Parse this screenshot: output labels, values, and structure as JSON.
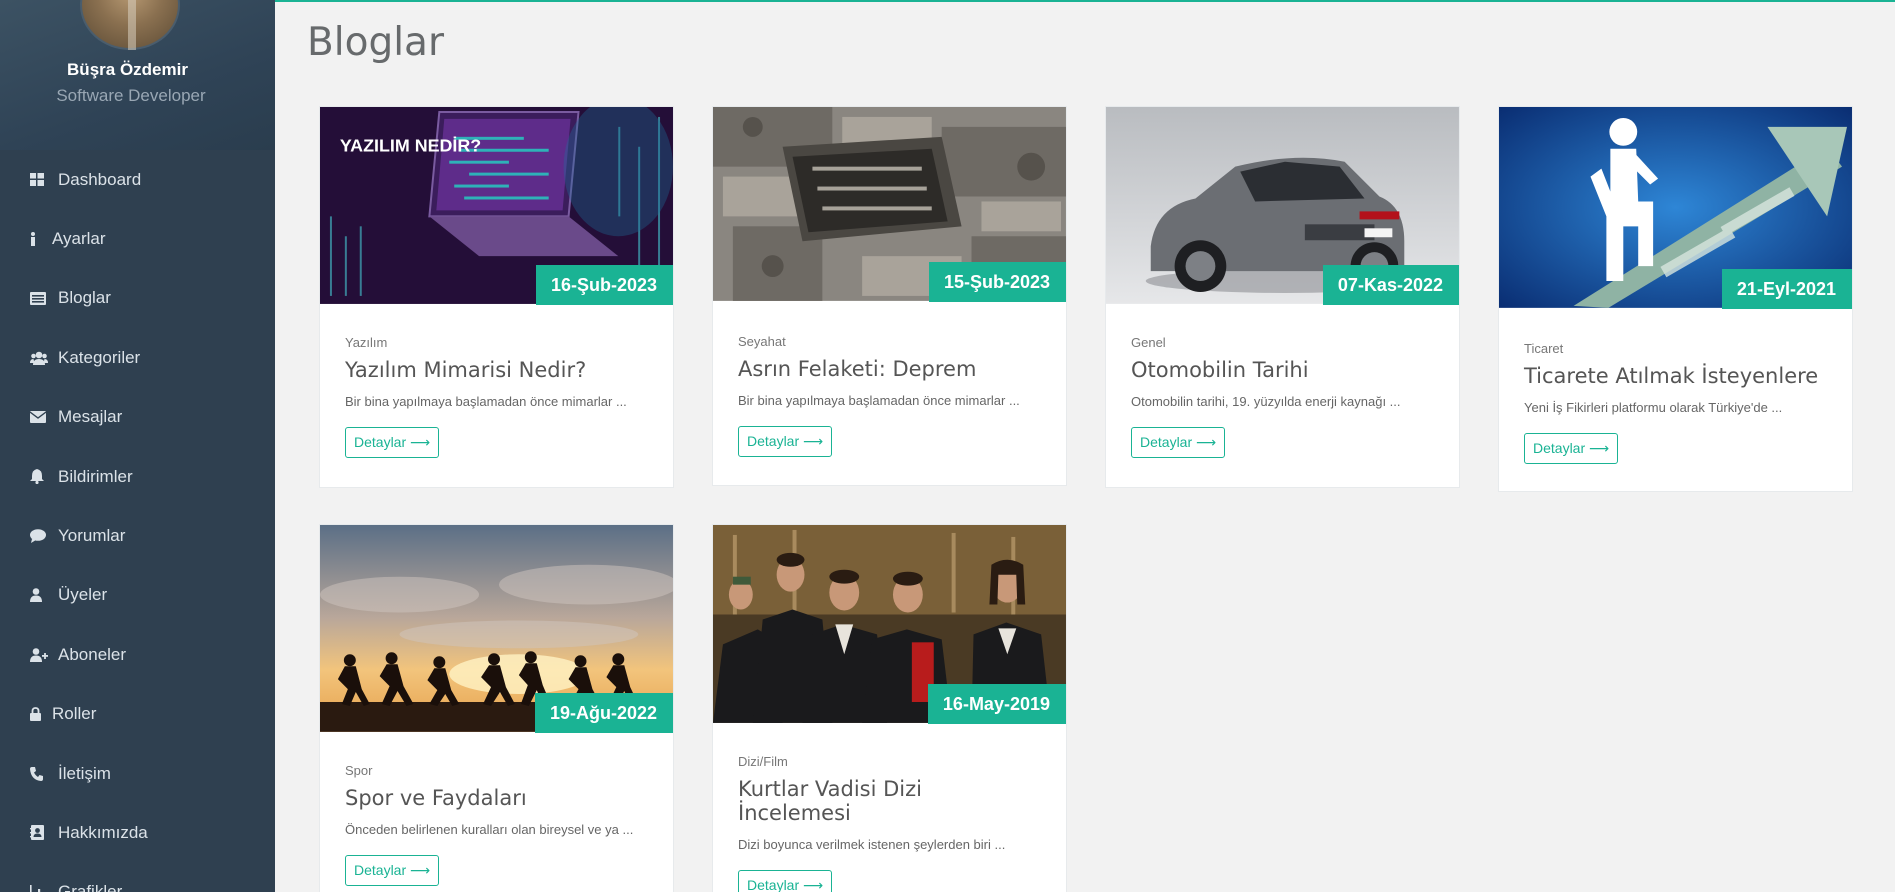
{
  "profile": {
    "name": "Büşra Özdemir",
    "role": "Software Developer"
  },
  "sidebar": {
    "items": [
      {
        "label": "Dashboard",
        "icon": "dashboard-icon"
      },
      {
        "label": "Ayarlar",
        "icon": "info-icon"
      },
      {
        "label": "Bloglar",
        "icon": "list-alt-icon"
      },
      {
        "label": "Kategoriler",
        "icon": "users-icon"
      },
      {
        "label": "Mesajlar",
        "icon": "envelope-icon"
      },
      {
        "label": "Bildirimler",
        "icon": "bell-icon"
      },
      {
        "label": "Yorumlar",
        "icon": "comment-icon"
      },
      {
        "label": "Üyeler",
        "icon": "user-icon"
      },
      {
        "label": "Aboneler",
        "icon": "user-plus-icon"
      },
      {
        "label": "Roller",
        "icon": "lock-icon"
      },
      {
        "label": "İletişim",
        "icon": "phone-icon"
      },
      {
        "label": "Hakkımızda",
        "icon": "address-book-icon"
      },
      {
        "label": "Grafikler",
        "icon": "chart-icon"
      }
    ]
  },
  "main": {
    "title": "Bloglar",
    "cards": [
      {
        "date": "16-Şub-2023",
        "category": "Yazılım",
        "title": "Yazılım Mimarisi Nedir?",
        "excerpt": "Bir bina yapılmaya başlamadan önce mimarlar ...",
        "button": "Detaylar ⟶",
        "image_text": "YAZILIM NEDİR?"
      },
      {
        "date": "15-Şub-2023",
        "category": "Seyahat",
        "title": "Asrın Felaketi: Deprem",
        "excerpt": "Bir bina yapılmaya başlamadan önce mimarlar ...",
        "button": "Detaylar ⟶"
      },
      {
        "date": "07-Kas-2022",
        "category": "Genel",
        "title": "Otomobilin Tarihi",
        "excerpt": "Otomobilin tarihi, 19. yüzyılda enerji kaynağı ...",
        "button": "Detaylar ⟶"
      },
      {
        "date": "21-Eyl-2021",
        "category": "Ticaret",
        "title": "Ticarete Atılmak İsteyenlere",
        "excerpt": "Yeni İş Fikirleri platformu olarak Türkiye'de ...",
        "button": "Detaylar ⟶"
      },
      {
        "date": "19-Ağu-2022",
        "category": "Spor",
        "title": "Spor ve Faydaları",
        "excerpt": "Önceden belirlenen kuralları olan bireysel ve ya ...",
        "button": "Detaylar ⟶"
      },
      {
        "date": "16-May-2019",
        "category": "Dizi/Film",
        "title": "Kurtlar Vadisi Dizi İncelemesi",
        "excerpt": "Dizi boyunca verilmek istenen şeylerden biri ...",
        "button": "Detaylar ⟶"
      }
    ]
  },
  "colors": {
    "accent": "#1ab394",
    "sidebar": "#2f4050",
    "background": "#f2f2f2"
  }
}
